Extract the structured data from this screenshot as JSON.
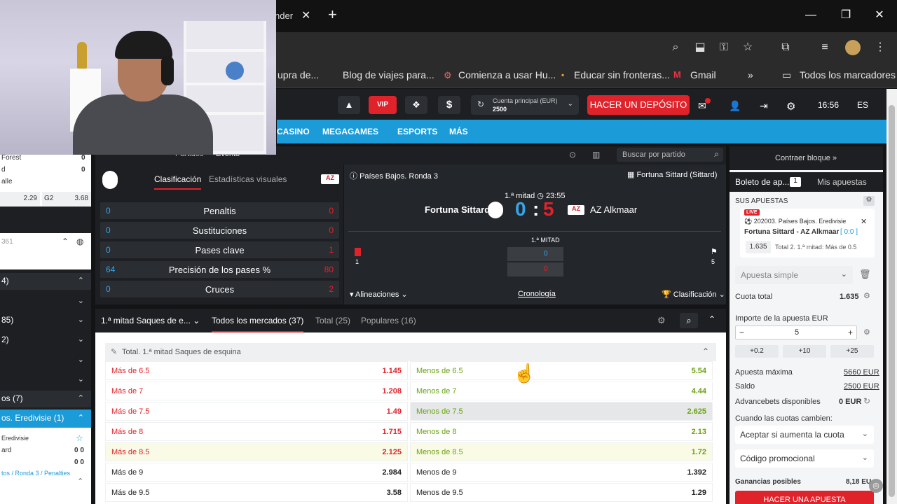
{
  "browser": {
    "tab_partial": "nder",
    "tab_close": "✕",
    "new_tab": "+",
    "bookmarks": [
      "upra de...",
      "Blog de viajes para...",
      "Comienza a usar Hu...",
      "Educar sin fronteras...",
      "Gmail",
      "»",
      "Todos los marcadores"
    ]
  },
  "header": {
    "vip": "VIP",
    "account_label": "Cuenta principal  (EUR)",
    "account_balance": "2500",
    "deposit": "HACER UN DEPÓSITO",
    "time": "16:56",
    "lang": "ES"
  },
  "nav": [
    "CASINO",
    "MEGAGAMES",
    "ESPORTS",
    "MÁS"
  ],
  "left": {
    "m1": "Forest",
    "m1v": "0",
    "m2": "d",
    "m2v": "0",
    "m3": "alle",
    "o1": "2.29",
    "o2l": "G2",
    "o2": "3.68",
    "num": "361",
    "r1": "4)",
    "r2": "85)",
    "r3": "2)",
    "league_count": "os (7)",
    "league": "os. Eredivisie (1)",
    "league_small": "Eredivisie",
    "team": "ard",
    "s1": "0 0",
    "s2": "0 0",
    "path": "tos / Ronda 3 / Penalties"
  },
  "matchbar": {
    "partidos": "Partidos",
    "evento": "Evento",
    "search": "Buscar por partido"
  },
  "stats": {
    "tab1": "Clasificación",
    "tab2": "Estadísticas visuales",
    "rows": [
      {
        "l": "0",
        "name": "Penaltis",
        "r": "0"
      },
      {
        "l": "0",
        "name": "Sustituciones",
        "r": "0"
      },
      {
        "l": "0",
        "name": "Pases clave",
        "r": "1"
      },
      {
        "l": "64",
        "name": "Precisión de los pases %",
        "r": "80"
      },
      {
        "l": "0",
        "name": "Cruces",
        "r": "2"
      }
    ]
  },
  "score": {
    "league": "Países Bajos. Ronda 3",
    "venue": "Fortuna Sittard (Sittard)",
    "period": "1.ª mitad",
    "clock": "23:55",
    "home": "Fortuna Sittard",
    "home_score": "0",
    "sep": ":",
    "away_score": "5",
    "away": "AZ Alkmaar",
    "half_label": "1.ª MITAD",
    "corners_h": "0",
    "corners_a": "0",
    "card_h": "1",
    "card_a": "5",
    "lineups": "Alineaciones",
    "timeline": "Cronología",
    "standings": "Clasificación"
  },
  "markets": {
    "selected": "1.ª mitad Saques de e...",
    "all": "Todos los mercados (37)",
    "total": "Total (25)",
    "popular": "Populares (16)",
    "group_title": "Total. 1.ª mitad Saques de esquina",
    "rows": [
      {
        "ol": "Más de 6.5",
        "ov": "1.145",
        "ul": "Menos de 6.5",
        "uv": "5.54",
        "style": "red"
      },
      {
        "ol": "Más de 7",
        "ov": "1.208",
        "ul": "Menos de 7",
        "uv": "4.44",
        "style": "red"
      },
      {
        "ol": "Más de 7.5",
        "ov": "1.49",
        "ul": "Menos de 7.5",
        "uv": "2.625",
        "style": "red"
      },
      {
        "ol": "Más de 8",
        "ov": "1.715",
        "ul": "Menos de 8",
        "uv": "2.13",
        "style": "red"
      },
      {
        "ol": "Más de 8.5",
        "ov": "2.125",
        "ul": "Menos de 8.5",
        "uv": "1.72",
        "style": "red"
      },
      {
        "ol": "Más de 9",
        "ov": "2.984",
        "ul": "Menos de 9",
        "uv": "1.392",
        "style": "dark"
      },
      {
        "ol": "Más de 9.5",
        "ov": "3.58",
        "ul": "Menos de 9.5",
        "uv": "1.29",
        "style": "dark"
      }
    ]
  },
  "slip": {
    "collapse": "Contraer bloque »",
    "tab1": "Boleto de ap...",
    "tab1_count": "1",
    "tab2": "Mis apuestas",
    "my_bets": "SUS APUESTAS",
    "live": "LIVE",
    "event_league": "202003. Países Bajos. Eredivisie",
    "event_teams": "Fortuna Sittard - AZ Alkmaar",
    "event_score": "[ 0:0 ]",
    "bet_odd": "1.635",
    "bet_desc": "Total 2. 1.ª mitad: Más de 0.5",
    "bet_type": "Apuesta simple",
    "total_odds_label": "Cuota total",
    "total_odds": "1.635",
    "stake_label": "Importe de la apuesta EUR",
    "stake": "5",
    "minus": "−",
    "plus": "+",
    "q1": "+0.2",
    "q2": "+10",
    "q3": "+25",
    "max_label": "Apuesta máxima",
    "max": "5660 EUR",
    "bal_label": "Saldo",
    "bal": "2500 EUR",
    "adv_label": "Advancebets disponibles",
    "adv": "0 EUR",
    "change_label": "Cuando las cuotas cambien:",
    "change": "Aceptar si aumenta la cuota",
    "promo": "Código promocional",
    "win_label": "Ganancias posibles",
    "win": "8,18 EU",
    "place": "HACER UNA APUESTA"
  }
}
